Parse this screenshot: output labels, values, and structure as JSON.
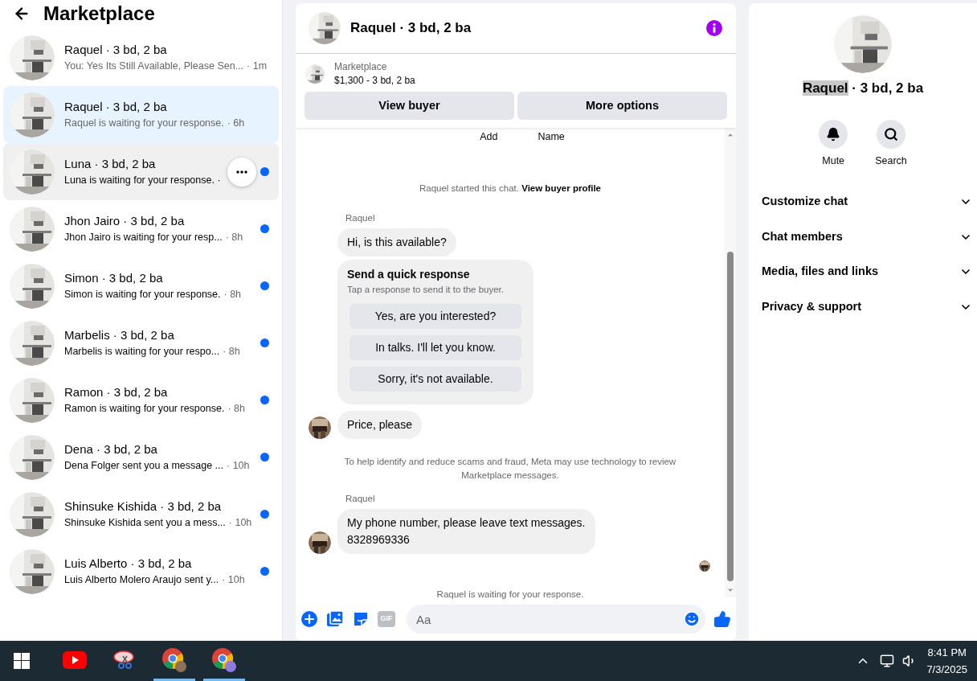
{
  "sidebar": {
    "title": "Marketplace",
    "items": [
      {
        "name": "Raquel · 3 bd, 2 ba",
        "preview": "You: Yes Its Still Available, Please Sen...",
        "time": "· 1m",
        "unread": false,
        "selected": false,
        "hovered": false
      },
      {
        "name": "Raquel · 3 bd, 2 ba",
        "preview": "Raquel is waiting for your response.",
        "time": "· 6h",
        "unread": false,
        "selected": true,
        "hovered": false
      },
      {
        "name": "Luna · 3 bd, 2 ba",
        "preview": "Luna is waiting for your response. ·",
        "unread": true,
        "selected": false,
        "hovered": true
      },
      {
        "name": "Jhon Jairo · 3 bd, 2 ba",
        "preview": "Jhon Jairo is waiting for your resp...",
        "time": "· 8h",
        "unread": true,
        "selected": false,
        "hovered": false
      },
      {
        "name": "Simon · 3 bd, 2 ba",
        "preview": "Simon is waiting for your response.",
        "time": "· 8h",
        "unread": true,
        "selected": false,
        "hovered": false
      },
      {
        "name": "Marbelis · 3 bd, 2 ba",
        "preview": "Marbelis is waiting for your respo...",
        "time": "· 8h",
        "unread": true,
        "selected": false,
        "hovered": false
      },
      {
        "name": "Ramon · 3 bd, 2 ba",
        "preview": "Ramon is waiting for your response.",
        "time": "· 8h",
        "unread": true,
        "selected": false,
        "hovered": false
      },
      {
        "name": "Dena · 3 bd, 2 ba",
        "preview": "Dena Folger sent you a message ...",
        "time": "· 10h",
        "unread": true,
        "selected": false,
        "hovered": false
      },
      {
        "name": "Shinsuke Kishida · 3 bd, 2 ba",
        "preview": "Shinsuke Kishida sent you a mess...",
        "time": "· 10h",
        "unread": true,
        "selected": false,
        "hovered": false
      },
      {
        "name": "Luis Alberto · 3 bd, 2 ba",
        "preview": "Luis Alberto Molero Araujo sent y...",
        "time": "· 10h",
        "unread": true,
        "selected": false,
        "hovered": false
      }
    ]
  },
  "chat": {
    "title": "Raquel · 3 bd, 2 ba",
    "listing": {
      "source": "Marketplace",
      "summary": "$1,300 - 3 bd, 2 ba"
    },
    "buttons": [
      "View buyer",
      "More options"
    ],
    "top_labels": [
      "Add",
      "Name"
    ],
    "timeline": [
      {
        "kind": "started",
        "text": "Raquel started this chat.",
        "link": "View buyer profile"
      },
      {
        "kind": "incoming",
        "sender": "Raquel",
        "text": "Hi, is this available?",
        "show_avatar": false
      },
      {
        "kind": "quick_responses",
        "title": "Send a quick response",
        "subtitle": "Tap a response to send it to the buyer.",
        "options": [
          "Yes, are you interested?",
          "In talks. I'll let you know.",
          "Sorry, it's not available."
        ]
      },
      {
        "kind": "incoming",
        "text": "Price, please",
        "show_avatar": true
      },
      {
        "kind": "notice",
        "text": "To help identify and reduce scams and fraud, Meta may use technology to review Marketplace messages."
      },
      {
        "kind": "incoming",
        "sender": "Raquel",
        "text": "My phone number, please leave text messages.\n8328969336",
        "show_avatar": true
      },
      {
        "kind": "seen"
      },
      {
        "kind": "notice",
        "text": "Raquel is waiting for your response."
      }
    ],
    "composer": {
      "gif_label": "GIF",
      "placeholder": "Aa"
    }
  },
  "details": {
    "title_parts": [
      {
        "text": "Raquel",
        "highlighted": true
      },
      {
        "text": " · 3 bd, 2 ba",
        "highlighted": false
      }
    ],
    "actions": [
      {
        "kind": "mute",
        "label": "Mute"
      },
      {
        "kind": "search",
        "label": "Search"
      }
    ],
    "sections": [
      "Customize chat",
      "Chat members",
      "Media, files and links",
      "Privacy & support"
    ]
  },
  "taskbar": {
    "apps": [
      {
        "kind": "youtube",
        "active": false
      },
      {
        "kind": "snip",
        "active": false
      },
      {
        "kind": "chrome",
        "active": true
      },
      {
        "kind": "chrome2",
        "active": true
      }
    ],
    "time": "8:41 PM",
    "date": "7/3/2025"
  }
}
